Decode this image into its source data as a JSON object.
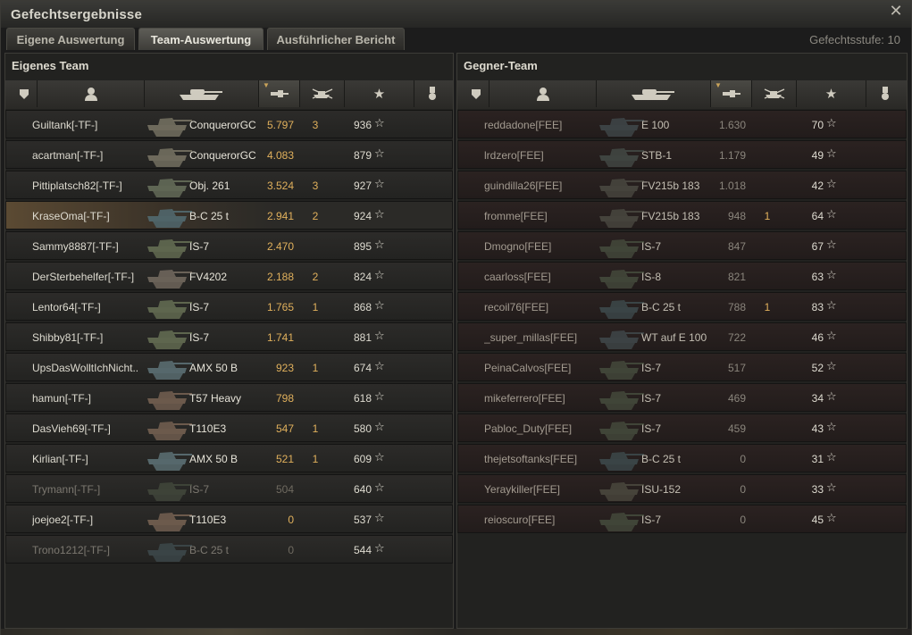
{
  "window": {
    "title": "Gefechtsergebnisse"
  },
  "tabs": [
    {
      "label": "Eigene Auswertung",
      "active": false
    },
    {
      "label": "Team-Auswertung",
      "active": true
    },
    {
      "label": "Ausführlicher Bericht",
      "active": false
    }
  ],
  "battle_tier": "Gefechtsstufe: 10",
  "colors": {
    "damage": "#e0b05c",
    "self_highlight": "#5b4a33",
    "enemy_row": "#2b2221"
  },
  "columns": [
    {
      "icon": "squad-icon"
    },
    {
      "icon": "player-icon"
    },
    {
      "icon": "tank-icon"
    },
    {
      "icon": "damage-icon",
      "sorted": true
    },
    {
      "icon": "kills-icon"
    },
    {
      "icon": "xp-star-icon"
    },
    {
      "icon": "medal-icon"
    }
  ],
  "own_team": {
    "title": "Eigenes Team",
    "players": [
      {
        "name": "Guiltank[-TF-]",
        "tank": "ConquerorGC",
        "damage": "5.797",
        "kills": "3",
        "xp": "936",
        "state": "alive",
        "hull": "#6e6a5c"
      },
      {
        "name": "acartman[-TF-]",
        "tank": "ConquerorGC",
        "damage": "4.083",
        "kills": "",
        "xp": "879",
        "state": "alive",
        "hull": "#6e6a5c"
      },
      {
        "name": "Pittiplatsch82[-TF-]",
        "tank": "Obj. 261",
        "damage": "3.524",
        "kills": "3",
        "xp": "927",
        "state": "alive",
        "hull": "#5f6654"
      },
      {
        "name": "KraseOma[-TF-]",
        "tank": "B-C 25 t",
        "damage": "2.941",
        "kills": "2",
        "xp": "924",
        "state": "self",
        "hull": "#4f6468"
      },
      {
        "name": "Sammy8887[-TF-]",
        "tank": "IS-7",
        "damage": "2.470",
        "kills": "",
        "xp": "895",
        "state": "alive",
        "hull": "#5e664e"
      },
      {
        "name": "DerSterbehelfer[-TF-]",
        "tank": "FV4202",
        "damage": "2.188",
        "kills": "2",
        "xp": "824",
        "state": "alive",
        "hull": "#6a6258"
      },
      {
        "name": "Lentor64[-TF-]",
        "tank": "IS-7",
        "damage": "1.765",
        "kills": "1",
        "xp": "868",
        "state": "alive",
        "hull": "#5e664e"
      },
      {
        "name": "Shibby81[-TF-]",
        "tank": "IS-7",
        "damage": "1.741",
        "kills": "",
        "xp": "881",
        "state": "alive",
        "hull": "#5e664e"
      },
      {
        "name": "UpsDasWolltIchNicht...",
        "tank": "AMX 50 B",
        "damage": "923",
        "kills": "1",
        "xp": "674",
        "state": "alive",
        "hull": "#56686c"
      },
      {
        "name": "hamun[-TF-]",
        "tank": "T57 Heavy",
        "damage": "798",
        "kills": "",
        "xp": "618",
        "state": "alive",
        "hull": "#6c5a4c"
      },
      {
        "name": "DasVieh69[-TF-]",
        "tank": "T110E3",
        "damage": "547",
        "kills": "1",
        "xp": "580",
        "state": "alive",
        "hull": "#6c5a4c"
      },
      {
        "name": "Kirlian[-TF-]",
        "tank": "AMX 50 B",
        "damage": "521",
        "kills": "1",
        "xp": "609",
        "state": "alive",
        "hull": "#56686c"
      },
      {
        "name": "Trymann[-TF-]",
        "tank": "IS-7",
        "damage": "504",
        "kills": "",
        "xp": "640",
        "state": "dead",
        "hull": "#3e4338"
      },
      {
        "name": "joejoe2[-TF-]",
        "tank": "T110E3",
        "damage": "0",
        "kills": "",
        "xp": "537",
        "state": "alive",
        "hull": "#6c5a4c"
      },
      {
        "name": "Trono1212[-TF-]",
        "tank": "B-C 25 t",
        "damage": "0",
        "kills": "",
        "xp": "544",
        "state": "dead",
        "hull": "#3a4446"
      }
    ]
  },
  "enemy_team": {
    "title": "Gegner-Team",
    "players": [
      {
        "name": "reddadone[FEE]",
        "tank": "E 100",
        "damage": "1.630",
        "kills": "",
        "xp": "70",
        "hull": "#3c4244"
      },
      {
        "name": "lrdzero[FEE]",
        "tank": "STB-1",
        "damage": "1.179",
        "kills": "",
        "xp": "49",
        "hull": "#3f4440"
      },
      {
        "name": "guindilla26[FEE]",
        "tank": "FV215b 183",
        "damage": "1.018",
        "kills": "",
        "xp": "42",
        "hull": "#45433c"
      },
      {
        "name": "fromme[FEE]",
        "tank": "FV215b 183",
        "damage": "948",
        "kills": "1",
        "xp": "64",
        "hull": "#45433c"
      },
      {
        "name": "Dmogno[FEE]",
        "tank": "IS-7",
        "damage": "847",
        "kills": "",
        "xp": "67",
        "hull": "#404538"
      },
      {
        "name": "caarloss[FEE]",
        "tank": "IS-8",
        "damage": "821",
        "kills": "",
        "xp": "63",
        "hull": "#404538"
      },
      {
        "name": "recoil76[FEE]",
        "tank": "B-C 25 t",
        "damage": "788",
        "kills": "1",
        "xp": "83",
        "hull": "#3a4446"
      },
      {
        "name": "_super_millas[FEE]",
        "tank": "WT auf E 100",
        "damage": "722",
        "kills": "",
        "xp": "46",
        "hull": "#3c4244"
      },
      {
        "name": "PeinaCalvos[FEE]",
        "tank": "IS-7",
        "damage": "517",
        "kills": "",
        "xp": "52",
        "hull": "#404538"
      },
      {
        "name": "mikeferrero[FEE]",
        "tank": "IS-7",
        "damage": "469",
        "kills": "",
        "xp": "34",
        "hull": "#404538"
      },
      {
        "name": "Pabloc_Duty[FEE]",
        "tank": "IS-7",
        "damage": "459",
        "kills": "",
        "xp": "43",
        "hull": "#404538"
      },
      {
        "name": "thejetsoftanks[FEE]",
        "tank": "B-C 25 t",
        "damage": "0",
        "kills": "",
        "xp": "31",
        "hull": "#3a4446"
      },
      {
        "name": "Yeraykiller[FEE]",
        "tank": "ISU-152",
        "damage": "0",
        "kills": "",
        "xp": "33",
        "hull": "#46433a"
      },
      {
        "name": "reioscuro[FEE]",
        "tank": "IS-7",
        "damage": "0",
        "kills": "",
        "xp": "45",
        "hull": "#404538"
      }
    ]
  }
}
